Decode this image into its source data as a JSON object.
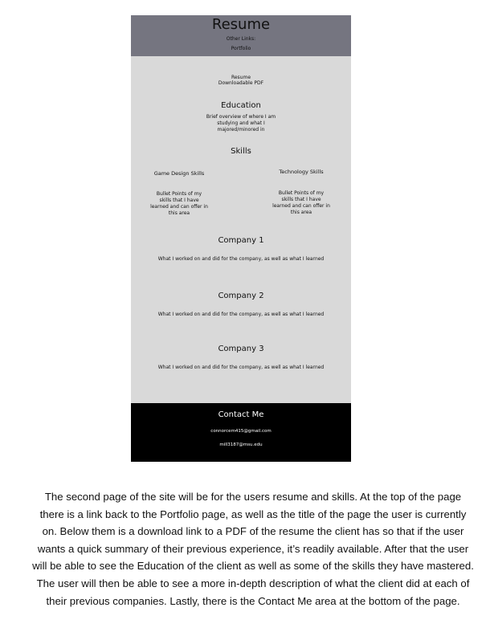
{
  "mockup": {
    "header": {
      "title": "Resume",
      "other_links_label": "Other Links:",
      "portfolio_link": "Portfolio"
    },
    "resume": {
      "label": "Resume",
      "download_pdf": "Downloadable PDF"
    },
    "education": {
      "title": "Education",
      "text": "Brief overview of where I am studying and what I majored/minored in"
    },
    "skills": {
      "title": "Skills",
      "game_design_title": "Game Design Skills",
      "technology_title": "Technology Skills",
      "game_design_text": "Bullet Points of my skills that I have learned and can offer in this area",
      "technology_text": "Bullet Points of my skills that I have learned and can offer in this area"
    },
    "companies": [
      {
        "title": "Company 1",
        "text": "What I worked on and did for the company, as well as what I learned"
      },
      {
        "title": "Company 2",
        "text": "What I worked on and did for the company, as well as what I learned"
      },
      {
        "title": "Company 3",
        "text": "What I worked on and did for the company, as well as what I learned"
      }
    ],
    "footer": {
      "contact_title": "Contact Me",
      "email_1": "connorcem415@gmail.com",
      "email_2": "mill3187@msu.edu"
    }
  },
  "caption": "The second page of the site will be for the users resume and skills. At the top of the page there is a link back to the Portfolio page, as well as the title of the page the user is currently on. Below them is a download link to a PDF of the resume the client has so that if the user wants a quick summary of their previous experience, it’s readily available. After that the user will be able to see the Education of the client as well as some of the skills they have mastered. The user will then be able to see a more in-depth description of what the client did at each of their previous companies. Lastly, there is the Contact Me area at the bottom of the page.",
  "colors": {
    "header_background": "#757580",
    "page_background": "#d9d9d9",
    "footer_background": "#000000"
  }
}
